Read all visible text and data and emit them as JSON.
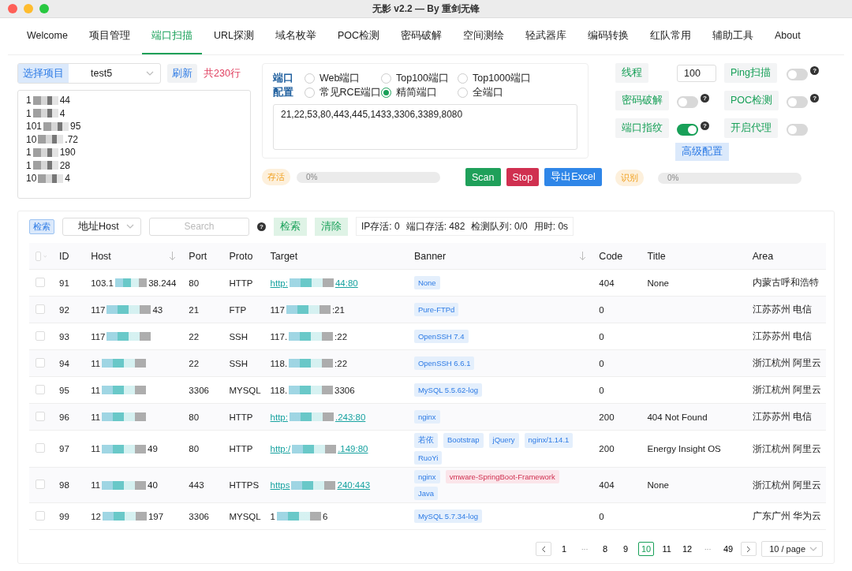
{
  "window": {
    "title": "无影 v2.2 — By 重剑无锋"
  },
  "tabs": [
    {
      "label": "Welcome",
      "selected": false
    },
    {
      "label": "项目管理",
      "selected": false
    },
    {
      "label": "端口扫描",
      "selected": true
    },
    {
      "label": "URL探测",
      "selected": false
    },
    {
      "label": "域名枚举",
      "selected": false
    },
    {
      "label": "POC检测",
      "selected": false
    },
    {
      "label": "密码破解",
      "selected": false
    },
    {
      "label": "空间测绘",
      "selected": false
    },
    {
      "label": "轻武器库",
      "selected": false
    },
    {
      "label": "编码转换",
      "selected": false
    },
    {
      "label": "红队常用",
      "selected": false
    },
    {
      "label": "辅助工具",
      "selected": false
    },
    {
      "label": "About",
      "selected": false
    }
  ],
  "project": {
    "label": "选择项目",
    "value": "test5",
    "refresh": "刷新",
    "count": "共230行",
    "lines": [
      {
        "head": "1",
        "tail": "44"
      },
      {
        "head": "1",
        "tail": "4"
      },
      {
        "head": "101",
        "tail": "95"
      },
      {
        "head": "10",
        "tail": ".72"
      },
      {
        "head": "1",
        "tail": "190"
      },
      {
        "head": "1",
        "tail": "28"
      },
      {
        "head": "10",
        "tail": "4"
      }
    ]
  },
  "ports": {
    "label_1": "端口",
    "label_2": "配置",
    "options": [
      {
        "label": "Web端口",
        "selected": false
      },
      {
        "label": "Top100端口",
        "selected": false
      },
      {
        "label": "Top1000端口",
        "selected": false
      },
      {
        "label": "常见RCE端口",
        "selected": false
      },
      {
        "label": "精简端口",
        "selected": true
      },
      {
        "label": "全端口",
        "selected": false
      }
    ],
    "value": "21,22,53,80,443,445,1433,3306,3389,8080"
  },
  "settings": {
    "threads_label": "线程",
    "threads": "100",
    "toggles": [
      {
        "label": "Ping扫描",
        "on": false,
        "help": "?"
      },
      {
        "label": "密码破解",
        "on": false,
        "help": "?"
      },
      {
        "label": "POC检测",
        "on": false,
        "help": "?"
      },
      {
        "label": "端口指纹",
        "on": true,
        "help": "?"
      },
      {
        "label": "开启代理",
        "on": false
      }
    ],
    "advanced": "高级配置"
  },
  "progress": [
    {
      "tag": "存活",
      "level": 0,
      "reading": "0%"
    },
    {
      "tag": "识别",
      "level": 0,
      "reading": "0%"
    }
  ],
  "actions": [
    {
      "label": "Scan",
      "kind": "success"
    },
    {
      "label": "Stop",
      "kind": "danger"
    },
    {
      "label": "导出Excel",
      "kind": "primary"
    }
  ],
  "filter": {
    "tag": "检索",
    "field": "地址Host",
    "placeholder": "Search",
    "help": "?",
    "search": "检索",
    "clear": "清除",
    "stats": [
      "IP存活: 0",
      "端口存活: 482",
      "检测队列: 0/0",
      "用时: 0s"
    ]
  },
  "table": {
    "select_all": false,
    "columns": [
      {
        "label": "ID",
        "sortable": false
      },
      {
        "label": "Host",
        "sortable": true
      },
      {
        "label": "Port",
        "sortable": false
      },
      {
        "label": "Proto",
        "sortable": false
      },
      {
        "label": "Target",
        "sortable": false
      },
      {
        "label": "Banner",
        "sortable": true
      },
      {
        "label": "Code",
        "sortable": false
      },
      {
        "label": "Title",
        "sortable": false
      },
      {
        "label": "Area",
        "sortable": false
      }
    ],
    "rows": [
      {
        "checked": false,
        "id": "91",
        "host": {
          "head": "103.1",
          "tail": "38.244"
        },
        "port": "80",
        "proto": "HTTP",
        "target": {
          "head": "http:",
          "tail": "44:80",
          "link": true
        },
        "banners": [
          {
            "text": "None",
            "kind": "info"
          }
        ],
        "code": "404",
        "title": "None",
        "area": "内蒙古呼和浩特"
      },
      {
        "checked": false,
        "id": "92",
        "host": {
          "head": "117",
          "tail": "43"
        },
        "port": "21",
        "proto": "FTP",
        "target": {
          "head": "117",
          "tail": ":21",
          "link": false
        },
        "banners": [
          {
            "text": "Pure-FTPd",
            "kind": "info"
          }
        ],
        "code": "0",
        "area": "江苏苏州 电信"
      },
      {
        "checked": false,
        "id": "93",
        "host": {
          "head": "117"
        },
        "port": "22",
        "proto": "SSH",
        "target": {
          "head": "117.",
          "tail": ":22",
          "link": false
        },
        "banners": [
          {
            "text": "OpenSSH 7.4",
            "kind": "info"
          }
        ],
        "code": "0",
        "area": "江苏苏州 电信"
      },
      {
        "checked": false,
        "id": "94",
        "host": {
          "head": "11"
        },
        "port": "22",
        "proto": "SSH",
        "target": {
          "head": "118.",
          "tail": ":22",
          "link": false
        },
        "banners": [
          {
            "text": "OpenSSH 6.6.1",
            "kind": "info"
          }
        ],
        "code": "0",
        "area": "浙江杭州 阿里云"
      },
      {
        "checked": false,
        "id": "95",
        "host": {
          "head": "11"
        },
        "port": "3306",
        "proto": "MYSQL",
        "target": {
          "head": "118.",
          "tail": "3306",
          "link": false
        },
        "banners": [
          {
            "text": "MySQL 5.5.62-log",
            "kind": "info"
          }
        ],
        "code": "0",
        "area": "浙江杭州 阿里云"
      },
      {
        "checked": false,
        "id": "96",
        "host": {
          "head": "11"
        },
        "port": "80",
        "proto": "HTTP",
        "target": {
          "head": "http:",
          "tail": ".243:80",
          "link": true
        },
        "banners": [
          {
            "text": "nginx",
            "kind": "info"
          }
        ],
        "code": "200",
        "title": "404 Not Found",
        "area": "江苏苏州 电信"
      },
      {
        "checked": false,
        "id": "97",
        "host": {
          "head": "11",
          "tail": "49"
        },
        "port": "80",
        "proto": "HTTP",
        "target": {
          "head": "http:/",
          "tail": ".149:80",
          "link": true
        },
        "banners": [
          {
            "text": "若依",
            "kind": "info"
          },
          {
            "text": "Bootstrap",
            "kind": "info"
          },
          {
            "text": "jQuery",
            "kind": "info"
          },
          {
            "text": "nginx/1.14.1",
            "kind": "info"
          },
          {
            "text": "RuoYi",
            "kind": "info"
          }
        ],
        "code": "200",
        "title": "Energy Insight OS",
        "area": "浙江杭州 阿里云"
      },
      {
        "checked": false,
        "id": "98",
        "host": {
          "head": "11",
          "tail": "40"
        },
        "port": "443",
        "proto": "HTTPS",
        "target": {
          "head": "https",
          "tail": "240:443",
          "link": true
        },
        "banners": [
          {
            "text": "nginx",
            "kind": "info"
          },
          {
            "text": "vmware-SpringBoot-Framework",
            "kind": "danger"
          },
          {
            "text": "Java",
            "kind": "info"
          }
        ],
        "code": "404",
        "title": "None",
        "area": "浙江杭州 阿里云"
      },
      {
        "checked": false,
        "id": "99",
        "host": {
          "head": "12",
          "tail": "197"
        },
        "port": "3306",
        "proto": "MYSQL",
        "target": {
          "head": "1",
          "tail": "6",
          "link": false
        },
        "banners": [
          {
            "text": "MySQL 5.7.34-log",
            "kind": "info"
          }
        ],
        "code": "0",
        "area": "广东广州 华为云"
      }
    ]
  },
  "pagination": {
    "items": [
      {
        "kind": "prev"
      },
      {
        "kind": "page",
        "label": "1",
        "selected": false
      },
      {
        "kind": "ellipsis",
        "label": "···"
      },
      {
        "kind": "page",
        "label": "8",
        "selected": false
      },
      {
        "kind": "page",
        "label": "9",
        "selected": false
      },
      {
        "kind": "page",
        "label": "10",
        "selected": true
      },
      {
        "kind": "page",
        "label": "11",
        "selected": false
      },
      {
        "kind": "page",
        "label": "12",
        "selected": false
      },
      {
        "kind": "ellipsis",
        "label": "···"
      },
      {
        "kind": "page",
        "label": "49",
        "selected": false
      },
      {
        "kind": "next"
      }
    ],
    "page_size": "10 / page"
  }
}
